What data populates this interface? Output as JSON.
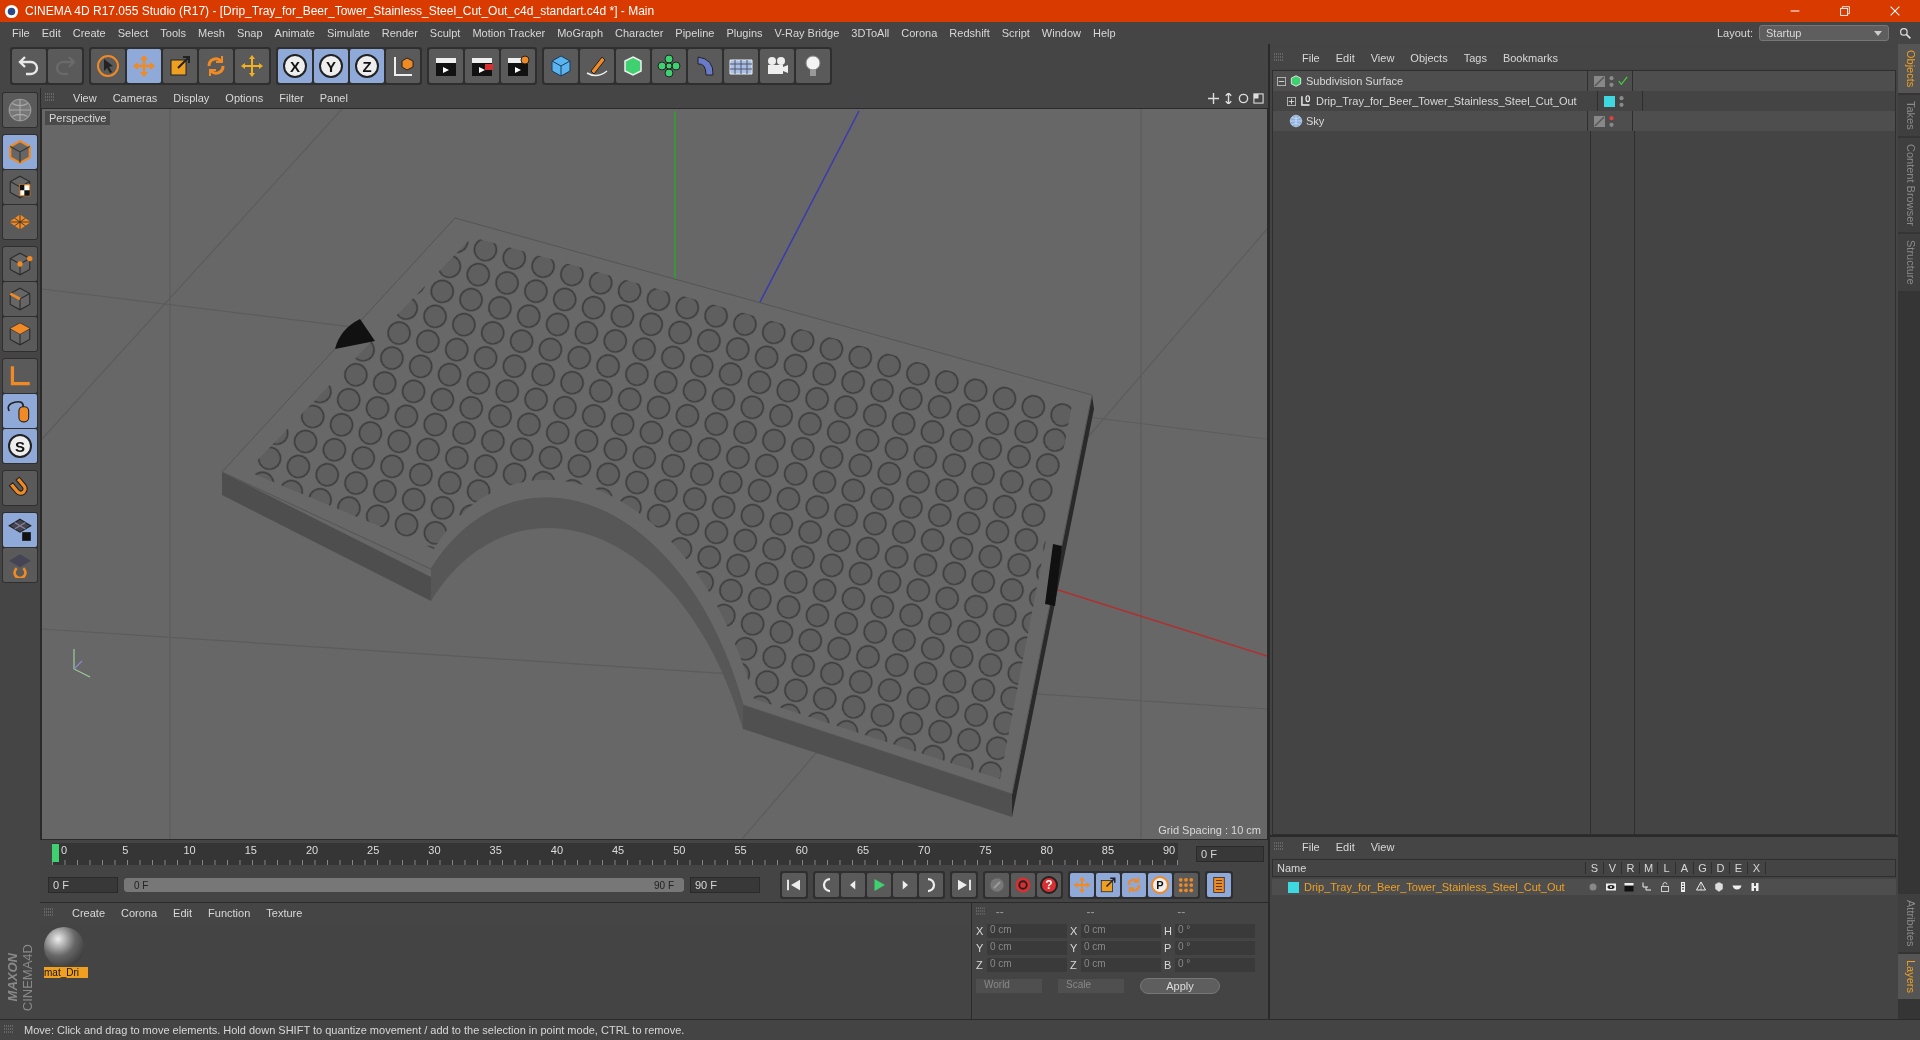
{
  "window": {
    "title": "CINEMA 4D R17.055 Studio (R17) - [Drip_Tray_for_Beer_Tower_Stainless_Steel_Cut_Out_c4d_standart.c4d *] - Main"
  },
  "menu_bar": {
    "items": [
      "File",
      "Edit",
      "Create",
      "Select",
      "Tools",
      "Mesh",
      "Snap",
      "Animate",
      "Simulate",
      "Render",
      "Sculpt",
      "Motion Tracker",
      "MoGraph",
      "Character",
      "Pipeline",
      "Plugins",
      "V-Ray Bridge",
      "3DToAll",
      "Corona",
      "Redshift",
      "Script",
      "Window",
      "Help"
    ],
    "layout_label": "Layout:",
    "layout_value": "Startup"
  },
  "toolbar": {
    "groups": [
      [
        {
          "kind": "undo",
          "selected": false
        },
        {
          "kind": "redo",
          "selected": false
        }
      ],
      [
        {
          "kind": "select",
          "selected": false
        },
        {
          "kind": "move",
          "selected": true
        },
        {
          "kind": "scale",
          "selected": false
        },
        {
          "kind": "rotate",
          "selected": false
        },
        {
          "kind": "add",
          "selected": false
        }
      ],
      [
        {
          "kind": "axis",
          "label": "X",
          "selected": true
        },
        {
          "kind": "axis",
          "label": "Y",
          "selected": true
        },
        {
          "kind": "axis",
          "label": "Z",
          "selected": true
        },
        {
          "kind": "coord",
          "selected": false
        }
      ],
      [
        {
          "kind": "render-view",
          "selected": false
        },
        {
          "kind": "render-picture",
          "selected": false
        },
        {
          "kind": "render-settings",
          "selected": false
        }
      ],
      [
        {
          "kind": "cube",
          "selected": false
        },
        {
          "kind": "pen",
          "selected": false
        },
        {
          "kind": "subdivision",
          "selected": false
        },
        {
          "kind": "cloner",
          "selected": false
        },
        {
          "kind": "deformer",
          "selected": false
        },
        {
          "kind": "floor",
          "selected": false
        },
        {
          "kind": "camera",
          "selected": false
        },
        {
          "kind": "light",
          "selected": false
        }
      ]
    ]
  },
  "left_toolbar": {
    "groups": [
      [
        {
          "kind": "make-editable",
          "selected": false
        }
      ],
      [
        {
          "kind": "model",
          "selected": true
        },
        {
          "kind": "texture",
          "selected": false
        },
        {
          "kind": "workplane",
          "selected": false
        }
      ],
      [
        {
          "kind": "points",
          "selected": false
        },
        {
          "kind": "edges",
          "selected": false
        },
        {
          "kind": "polygons",
          "selected": false
        }
      ],
      [
        {
          "kind": "axis-tool",
          "selected": false
        },
        {
          "kind": "tweak",
          "selected": true
        },
        {
          "kind": "snap",
          "label": "S",
          "selected": true
        }
      ],
      [
        {
          "kind": "magnet",
          "selected": false
        }
      ],
      [
        {
          "kind": "workplane-lock",
          "selected": true
        },
        {
          "kind": "workplane-rotate",
          "selected": false
        }
      ]
    ]
  },
  "logo": {
    "brand": "MAXON",
    "product": "CINEMA4D"
  },
  "viewport": {
    "menu": [
      "View",
      "Cameras",
      "Display",
      "Options",
      "Filter",
      "Panel"
    ],
    "camera_label": "Perspective",
    "grid_spacing": "Grid Spacing : 10 cm"
  },
  "timeline": {
    "ticks": [
      "0",
      "5",
      "10",
      "15",
      "20",
      "25",
      "30",
      "35",
      "40",
      "45",
      "50",
      "55",
      "60",
      "65",
      "70",
      "75",
      "80",
      "85",
      "90"
    ],
    "playhead": {
      "level": 0
    },
    "current_frame": "0 F",
    "start_frame": "0 F",
    "range": {
      "level": 1
    },
    "range_start": "0 F",
    "range_end": "90 F",
    "end_frame": "90 F"
  },
  "transport": {
    "groups": [
      [
        {
          "kind": "go-start",
          "selected": false
        }
      ],
      [
        {
          "kind": "prev-key",
          "selected": false
        },
        {
          "kind": "prev-frame",
          "selected": false
        },
        {
          "kind": "play",
          "selected": false
        },
        {
          "kind": "next-frame",
          "selected": false
        },
        {
          "kind": "next-key",
          "selected": false
        }
      ],
      [
        {
          "kind": "go-end",
          "selected": false
        }
      ],
      [
        {
          "kind": "keyframe",
          "selected": false
        },
        {
          "kind": "autokey",
          "selected": false
        },
        {
          "kind": "help",
          "label": "?",
          "selected": false
        }
      ],
      [
        {
          "kind": "move",
          "selected": true
        },
        {
          "kind": "scale",
          "selected": true
        },
        {
          "kind": "rotate",
          "selected": true
        },
        {
          "kind": "param",
          "label": "P",
          "selected": true
        },
        {
          "kind": "dot-grid",
          "selected": false
        }
      ],
      [
        {
          "kind": "film",
          "selected": true
        }
      ]
    ]
  },
  "materials": {
    "menu": [
      "Create",
      "Corona",
      "Edit",
      "Function",
      "Texture"
    ],
    "items": [
      {
        "name": "mat_Dri",
        "selected": true
      }
    ]
  },
  "coordinates": {
    "headers": [
      "--",
      "--",
      "--"
    ],
    "rows": [
      {
        "pos_axis": "X",
        "pos": "0 cm",
        "size_axis": "X",
        "size": "0 cm",
        "rot_axis": "H",
        "rot": "0 °"
      },
      {
        "pos_axis": "Y",
        "pos": "0 cm",
        "size_axis": "Y",
        "size": "0 cm",
        "rot_axis": "P",
        "rot": "0 °"
      },
      {
        "pos_axis": "Z",
        "pos": "0 cm",
        "size_axis": "Z",
        "size": "0 cm",
        "rot_axis": "B",
        "rot": "0 °"
      }
    ],
    "mode": "World",
    "size_mode": "Scale",
    "apply": "Apply"
  },
  "status_bar": "Move: Click and drag to move elements. Hold down SHIFT to quantize movement / add to the selection in point mode, CTRL to remove.",
  "objects_manager": {
    "menu": [
      "File",
      "Edit",
      "View",
      "Objects",
      "Tags",
      "Bookmarks"
    ],
    "objects": [
      {
        "name": "Subdivision Surface",
        "kind": "subdivision",
        "expanded": true,
        "enabled": true,
        "editor_visible": true,
        "children": [
          {
            "name": "Drip_Tray_for_Beer_Tower_Stainless_Steel_Cut_Out",
            "kind": "null",
            "expanded": false,
            "color": "#3dd8e0",
            "editor_visible": true
          }
        ]
      },
      {
        "name": "Sky",
        "kind": "sky",
        "editor_visible": false
      }
    ]
  },
  "right_tabs_top": [
    {
      "label": "Objects",
      "selected": true
    },
    {
      "label": "Takes",
      "selected": false
    },
    {
      "label": "Content Browser",
      "selected": false
    },
    {
      "label": "Structure",
      "selected": false
    }
  ],
  "layers_manager": {
    "menu": [
      "File",
      "Edit",
      "View"
    ],
    "columns": [
      "Name",
      "S",
      "V",
      "R",
      "M",
      "L",
      "A",
      "G",
      "D",
      "E",
      "X"
    ],
    "layers": [
      {
        "name": "Drip_Tray_for_Beer_Tower_Stainless_Steel_Cut_Out",
        "color": "#3dd8e0",
        "selected": true
      }
    ]
  },
  "right_tabs_bottom": [
    {
      "label": "Attributes",
      "selected": false
    },
    {
      "label": "Layers",
      "selected": true
    }
  ]
}
